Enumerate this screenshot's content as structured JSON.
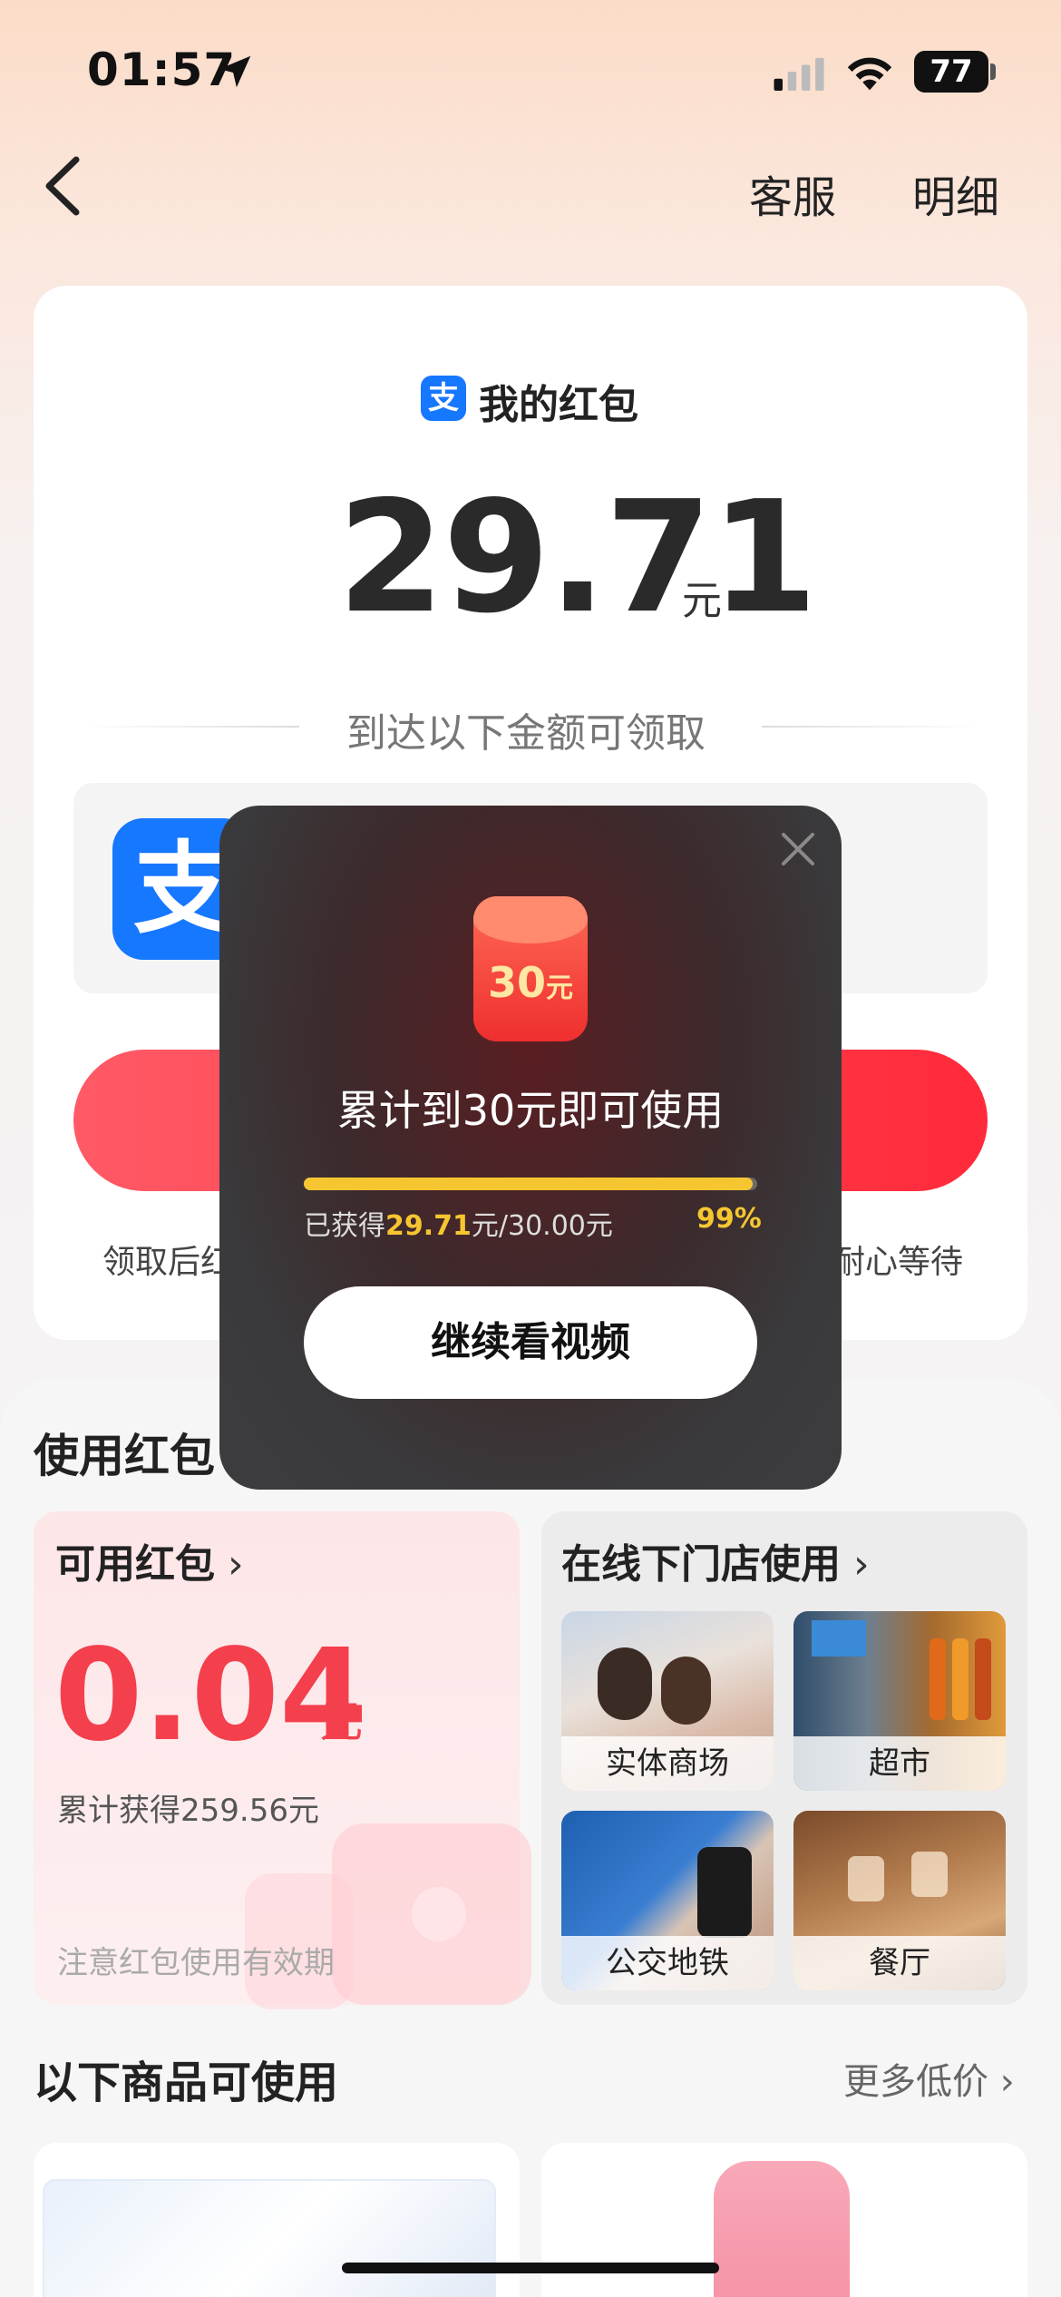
{
  "status_bar": {
    "time": "01:57",
    "battery": "77"
  },
  "nav": {
    "service_label": "客服",
    "detail_label": "明细"
  },
  "main_card": {
    "logo_char": "支",
    "title": "我的红包",
    "amount": "29.71",
    "unit": "元",
    "hint": "到达以下金额可领取",
    "foot_note_left": "领取后红",
    "foot_note_right": "耐心等待"
  },
  "use_section": {
    "title": "使用红包",
    "usable": {
      "title": "可用红包",
      "amount": "0.04",
      "unit": "元",
      "total_earned": "累计获得259.56元",
      "expiry_note": "注意红包使用有效期"
    },
    "stores": {
      "title": "在线下门店使用",
      "tiles": [
        {
          "label": "实体商场"
        },
        {
          "label": "超市"
        },
        {
          "label": "公交地铁"
        },
        {
          "label": "餐厅"
        }
      ]
    }
  },
  "products": {
    "title": "以下商品可使用",
    "more_label": "更多低价"
  },
  "modal": {
    "red_packet_value": "30",
    "red_packet_unit": "元",
    "heading": "累计到30元即可使用",
    "progress_prefix": "已获得",
    "progress_current": "29.71",
    "progress_suffix": "元/30.00元",
    "progress_percent": "99%",
    "progress_fraction": 0.99,
    "button_label": "继续看视频"
  },
  "colors": {
    "accent_red": "#ff2a3a",
    "brand_blue": "#1677ff",
    "progress_yellow": "#f6c631"
  }
}
